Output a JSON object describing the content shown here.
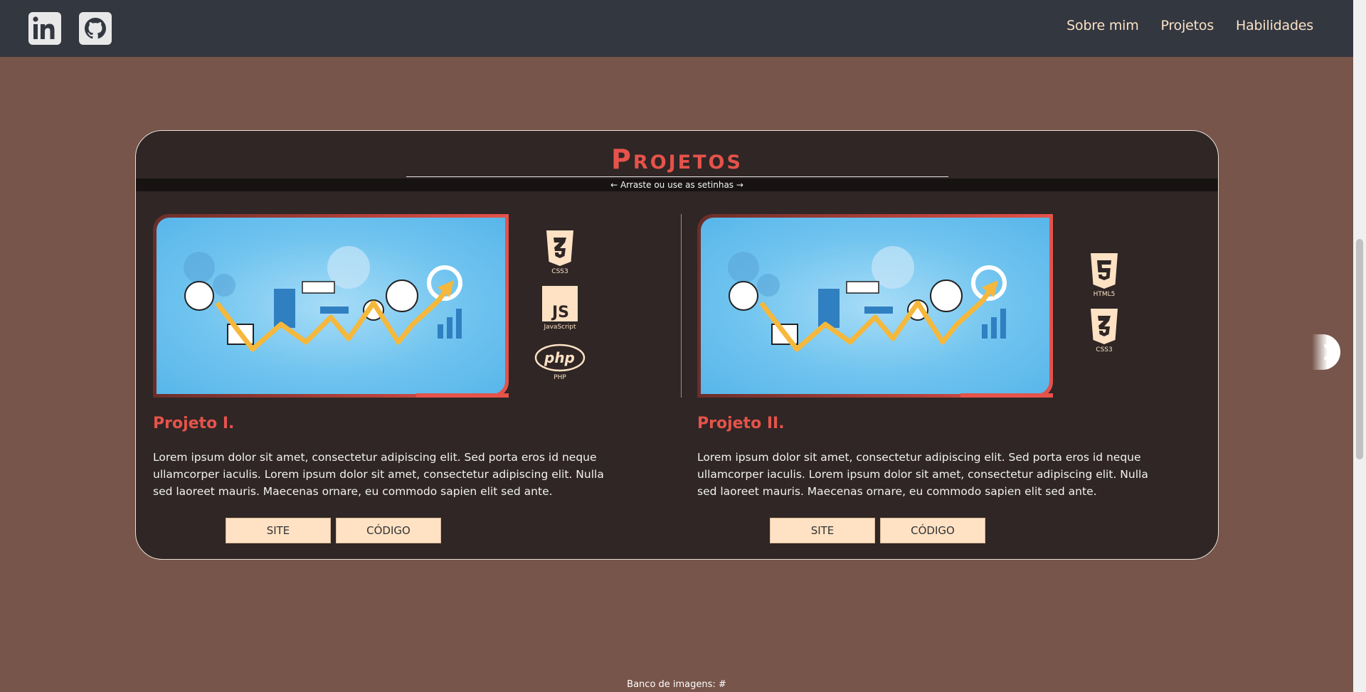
{
  "header": {
    "social": [
      {
        "icon": "linkedin-icon"
      },
      {
        "icon": "github-icon"
      }
    ],
    "nav": [
      "Sobre mim",
      "Projetos",
      "Habilidades"
    ]
  },
  "projects": {
    "title": "Projetos",
    "hint": "← Arraste ou use as setinhas →",
    "items": [
      {
        "title": "Projeto I.",
        "description": "Lorem ipsum dolor sit amet, consectetur adipiscing elit. Sed porta eros id neque ullamcorper iaculis. Lorem ipsum dolor sit amet, consectetur adipiscing elit. Nulla sed laoreet mauris. Maecenas ornare, eu commodo sapien elit sed ante.",
        "techs": [
          "CSS3",
          "JavaScript",
          "PHP"
        ],
        "site_label": "SITE",
        "code_label": "CÓDIGO"
      },
      {
        "title": "Projeto II.",
        "description": "Lorem ipsum dolor sit amet, consectetur adipiscing elit. Sed porta eros id neque ullamcorper iaculis. Lorem ipsum dolor sit amet, consectetur adipiscing elit. Nulla sed laoreet mauris. Maecenas ornare, eu commodo sapien elit sed ante.",
        "techs": [
          "HTML5",
          "CSS3"
        ],
        "site_label": "SITE",
        "code_label": "CÓDIGO"
      }
    ],
    "next_icon": "chevron-right-icon"
  },
  "footer": {
    "credits": "Banco de imagens: #"
  },
  "colors": {
    "background": "#77554a",
    "header": "#333740",
    "panel": "#2f2625",
    "accent": "#e5534b",
    "nav_text": "#fbe2c6",
    "button": "#ffe2c4"
  }
}
